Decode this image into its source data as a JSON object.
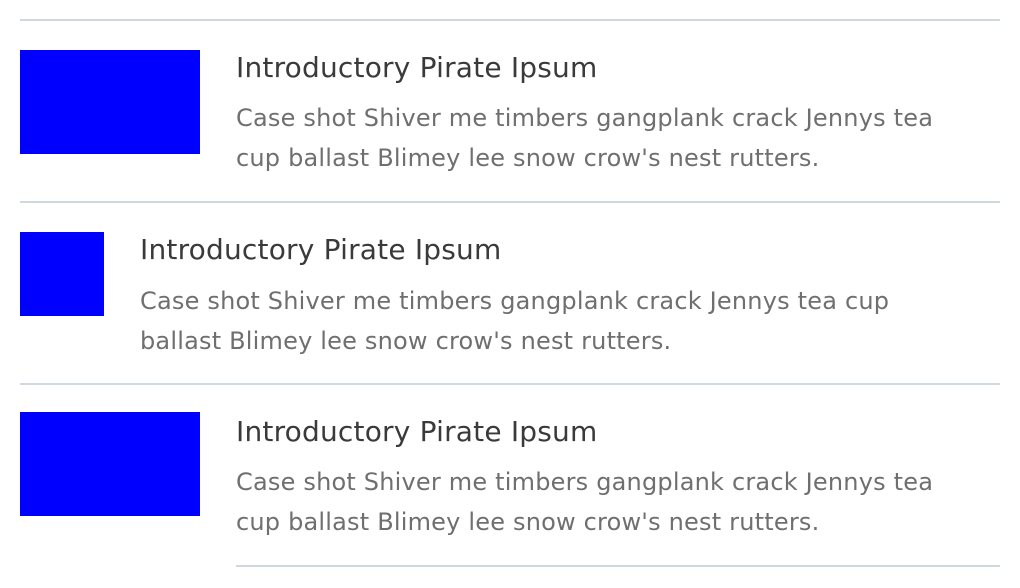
{
  "colors": {
    "thumbnail": "#0000ff",
    "divider": "#cfd8e0",
    "title_text": "#3a3a3a",
    "body_text": "#6f6f6f"
  },
  "items": [
    {
      "title": "Introductory Pirate Ipsum",
      "description": "Case shot Shiver me timbers gangplank crack Jennys tea cup ballast Blimey lee snow crow's nest rutters."
    },
    {
      "title": "Introductory Pirate Ipsum",
      "description": "Case shot Shiver me timbers gangplank crack Jennys tea cup ballast Blimey lee snow crow's nest rutters."
    },
    {
      "title": "Introductory Pirate Ipsum",
      "description": "Case shot Shiver me timbers gangplank crack Jennys tea cup ballast Blimey lee snow crow's nest rutters."
    }
  ]
}
